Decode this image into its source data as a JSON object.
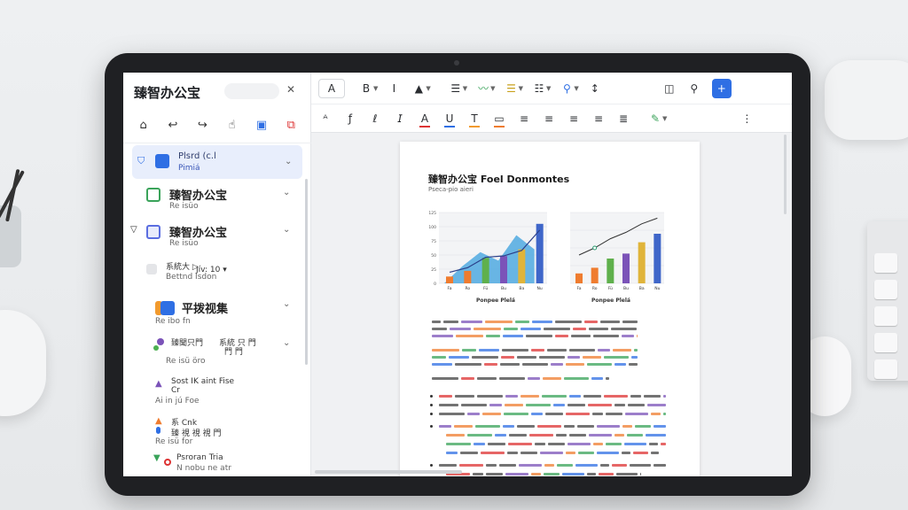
{
  "sidebar": {
    "title": "臻智办公宝",
    "items": [
      {
        "title": "Plsrd (c.l",
        "subtitle": "Pimiá"
      },
      {
        "title": "臻智办公宝",
        "subtitle": "Re isüo"
      },
      {
        "title": "臻智办公宝",
        "subtitle": "Re isüo"
      },
      {
        "line1": "系統大 ▷",
        "line2": "Jív:  10 ▾",
        "line3": "Bettnd  Isdon"
      },
      {
        "title": "平拨视集",
        "subtitle": "Re ibo fn"
      },
      {
        "line1": "臻聞只門",
        "line2": "系統 只 門",
        "line3": "Re isü öro",
        "line4": "門 門"
      },
      {
        "line1": "Sost  IK aint  Fise",
        "line2": "Cr",
        "line3": "Ai in jú   Foe"
      },
      {
        "line1": "系  Cnk",
        "line2": "臻 視 視  視 門",
        "line3": "Re isü for"
      },
      {
        "line1": "Psroran  Tria",
        "line2": "N nobu  ne  atr"
      }
    ]
  },
  "toolbar": {
    "font_label": "A",
    "bold": "B",
    "italic": "I"
  },
  "document": {
    "title": "臻智办公宝  Foel  Donmontes",
    "subtitle": "Pseca-pio aieri",
    "chart1": {
      "caption": "Ponpee  Plelá"
    },
    "chart2": {
      "caption": "Ponpee  Plelá"
    }
  },
  "colors": {
    "accent": "#2f6fe4",
    "bar_blue": "#3f66c9",
    "bar_orange": "#ef7c2f",
    "bar_green": "#5fb04c",
    "bar_purple": "#7b53b8",
    "bar_gold": "#e0b43a",
    "area_cyan": "#4fa9e0"
  },
  "chart_data": [
    {
      "type": "bar",
      "categories": [
        "Fa",
        "Ro",
        "Fü",
        "Bu",
        "Ba",
        "Nu"
      ],
      "values": [
        12,
        22,
        45,
        48,
        60,
        105
      ],
      "ylim": [
        0,
        125
      ],
      "yticks": [
        "0",
        "25",
        "50",
        "75",
        "100",
        "125"
      ],
      "caption": "Ponpee  Plelá"
    },
    {
      "type": "bar",
      "categories": [
        "Fa",
        "Ro",
        "Fü",
        "Bu",
        "Ba",
        "Nu"
      ],
      "values": [
        14,
        22,
        35,
        42,
        58,
        70
      ],
      "line": [
        40,
        50,
        63,
        72,
        84,
        92
      ],
      "ylim": [
        0,
        100
      ],
      "caption": "Ponpee  Plelá"
    }
  ]
}
